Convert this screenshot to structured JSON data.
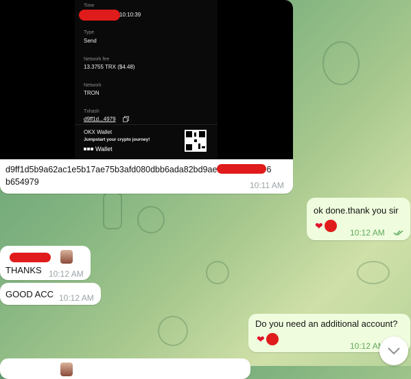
{
  "receipt": {
    "time_label": "Time",
    "time_value": "10:10:39",
    "type_label": "Type",
    "type_value": "Send",
    "fee_label": "Network fee",
    "fee_value": "13.3755 TRX  ($4.48)",
    "network_label": "Network",
    "network_value": "TRON",
    "txhash_label": "Txhash",
    "txhash_value": "d9ff1d...4979",
    "wallet_name": "OKX Wallet",
    "tagline": "Jumpstart your crypto journey!",
    "logo_text": "Wallet"
  },
  "messages": {
    "hash_line1": "d9ff1d5b9a62ac1e5b17ae75b3afd080dbb6ada82bd9ae",
    "hash_line1_tail": "6",
    "hash_line2": "b654979",
    "hash_time": "10:11 AM",
    "done_text": "ok done.thank you sir",
    "done_time": "10:12 AM",
    "thanks_text": "THANKS",
    "thanks_time": "10:12 AM",
    "good_text": "GOOD ACC",
    "good_time": "10:12 AM",
    "question_text": "Do you need an additional account?",
    "question_time": "10:12 AM"
  },
  "colors": {
    "accent_out": "#effdde",
    "reaction_red": "#e01b1b",
    "check_green": "#5fa85a"
  },
  "icons": {
    "copy": "copy-icon",
    "read": "double-check-icon",
    "scroll": "chevron-down-icon",
    "heart": "heart-icon"
  }
}
